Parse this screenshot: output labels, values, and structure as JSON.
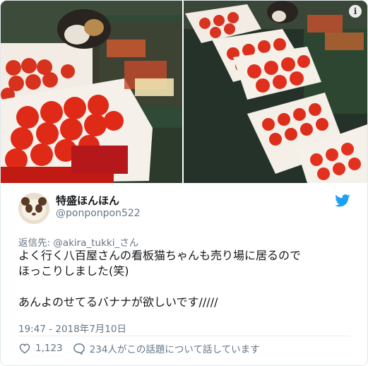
{
  "tweet": {
    "display_name": "特盛ほんほん",
    "handle": "@ponponpon522",
    "reply_to": "返信先: @akira_tukki_さん",
    "text": "よく行く八百屋さんの看板猫ちゃんも売り場に居るので\nほっこりしました(笑)\n\nあんよのせてるバナナが欲しいです/////",
    "timestamp": "19:47 - 2018年7月10日",
    "likes": "1,123",
    "replies": "234人がこの話題について話しています"
  },
  "media": {
    "left_alt": "",
    "right_alt": ""
  },
  "colors": {
    "twitter_blue": "#1da1f2",
    "secondary_text": "#657786"
  },
  "icons": [
    "info-icon",
    "twitter-bird-icon",
    "heart-icon",
    "speech-bubble-icon"
  ]
}
